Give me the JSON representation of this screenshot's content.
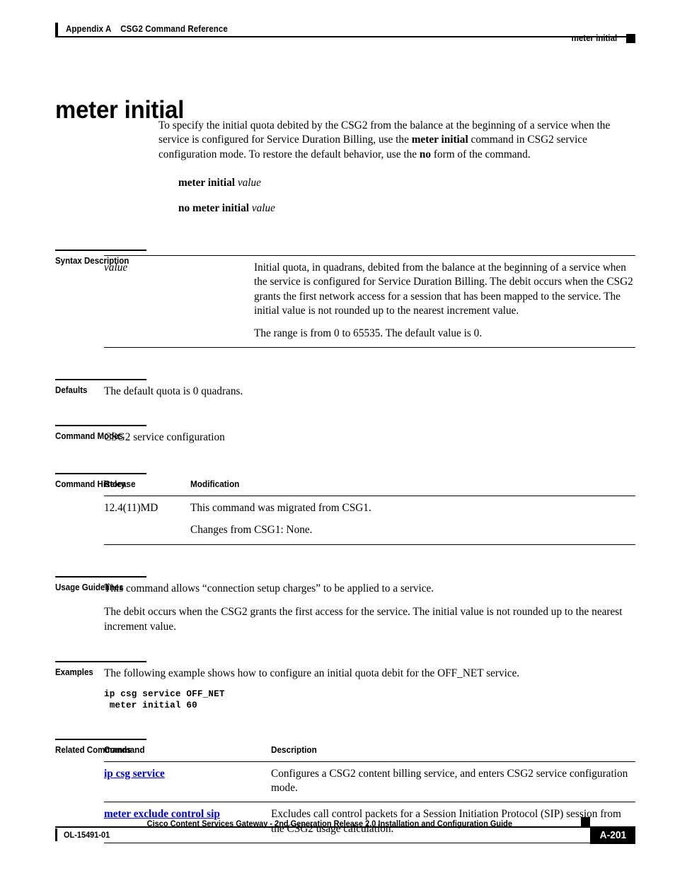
{
  "header": {
    "appendix": "Appendix A",
    "chapter": "CSG2 Command Reference",
    "running_head": "meter initial"
  },
  "title": "meter initial",
  "intro": {
    "part1": "To specify the initial quota debited by the CSG2 from the balance at the beginning of a service when the service is configured for Service Duration Billing, use the ",
    "bold1": "meter initial",
    "part2": " command in CSG2 service configuration mode. To restore the default behavior, use the ",
    "bold2": "no",
    "part3": " form of the command."
  },
  "syntax_lines": [
    {
      "command": "meter initial",
      "argument": "value"
    },
    {
      "command": "no meter initial",
      "argument": "value"
    }
  ],
  "sections": {
    "syntax_description": {
      "label": "Syntax Description",
      "rows": [
        {
          "term": "value",
          "paragraphs": [
            "Initial quota, in quadrans, debited from the balance at the beginning of a service when the service is configured for Service Duration Billing. The debit occurs when the CSG2 grants the first network access for a session that has been mapped to the service. The initial value is not rounded up to the nearest increment value.",
            "The range is from 0 to 65535. The default value is 0."
          ]
        }
      ]
    },
    "defaults": {
      "label": "Defaults",
      "text": "The default quota is 0 quadrans."
    },
    "command_modes": {
      "label": "Command Modes",
      "text": "CSG2 service configuration"
    },
    "command_history": {
      "label": "Command History",
      "columns": [
        "Release",
        "Modification"
      ],
      "rows": [
        {
          "release": "12.4(11)MD",
          "modification": [
            "This command was migrated from CSG1.",
            "Changes from CSG1: None."
          ]
        }
      ]
    },
    "usage_guidelines": {
      "label": "Usage Guidelines",
      "paragraphs": [
        "This command allows “connection setup charges” to be applied to a service.",
        "The debit occurs when the CSG2 grants the first access for the service. The initial value is not rounded up to the nearest increment value."
      ]
    },
    "examples": {
      "label": "Examples",
      "intro": "The following example shows how to configure an initial quota debit for the OFF_NET service.",
      "code": "ip csg service OFF_NET\n meter initial 60"
    },
    "related_commands": {
      "label": "Related Commands",
      "columns": [
        "Command",
        "Description"
      ],
      "rows": [
        {
          "command": "ip csg service",
          "description": "Configures a CSG2 content billing service, and enters CSG2 service configuration mode."
        },
        {
          "command": "meter exclude control sip",
          "description": "Excludes call control packets for a Session Initiation Protocol (SIP) session from the CSG2 usage calculation."
        }
      ]
    }
  },
  "footer": {
    "doc_title": "Cisco Content Services Gateway - 2nd Generation Release 2.0 Installation and Configuration Guide",
    "doc_id": "OL-15491-01",
    "page_number": "A-201"
  },
  "colors": {
    "link": "#0000cc",
    "rule": "#000000"
  }
}
